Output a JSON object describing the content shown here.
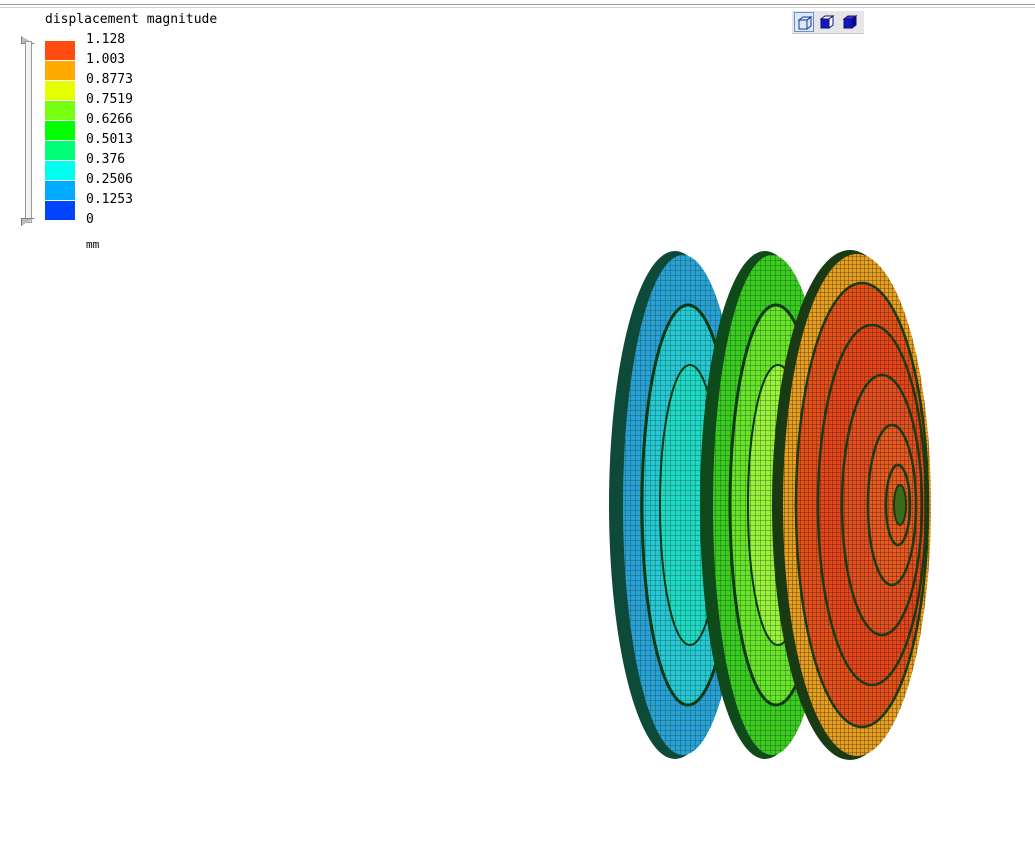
{
  "legend": {
    "title": "displacement magnitude",
    "unit": "mm",
    "entries": [
      {
        "value": "1.128",
        "color": "#ff4a10"
      },
      {
        "value": "1.003",
        "color": "#ffaa00"
      },
      {
        "value": "0.8773",
        "color": "#e6ff00"
      },
      {
        "value": "0.7519",
        "color": "#77ff11"
      },
      {
        "value": "0.6266",
        "color": "#00ff00"
      },
      {
        "value": "0.5013",
        "color": "#00ff77"
      },
      {
        "value": "0.376",
        "color": "#00ffee"
      },
      {
        "value": "0.2506",
        "color": "#00aaff"
      },
      {
        "value": "0.1253",
        "color": "#0044ff"
      },
      {
        "value": "0"
      }
    ]
  },
  "toolbar": {
    "buttons": [
      {
        "icon": "wireframe-cube-icon",
        "active": true
      },
      {
        "icon": "solid-cube-icon",
        "active": false
      },
      {
        "icon": "shaded-cube-icon",
        "active": false
      }
    ]
  },
  "model": {
    "description_colors": {
      "mesh_edge": "#0a3a14",
      "disc_rear": "#2aa0d8",
      "disc_middle": "#55d820",
      "disc_front": "#e84a1a"
    }
  }
}
